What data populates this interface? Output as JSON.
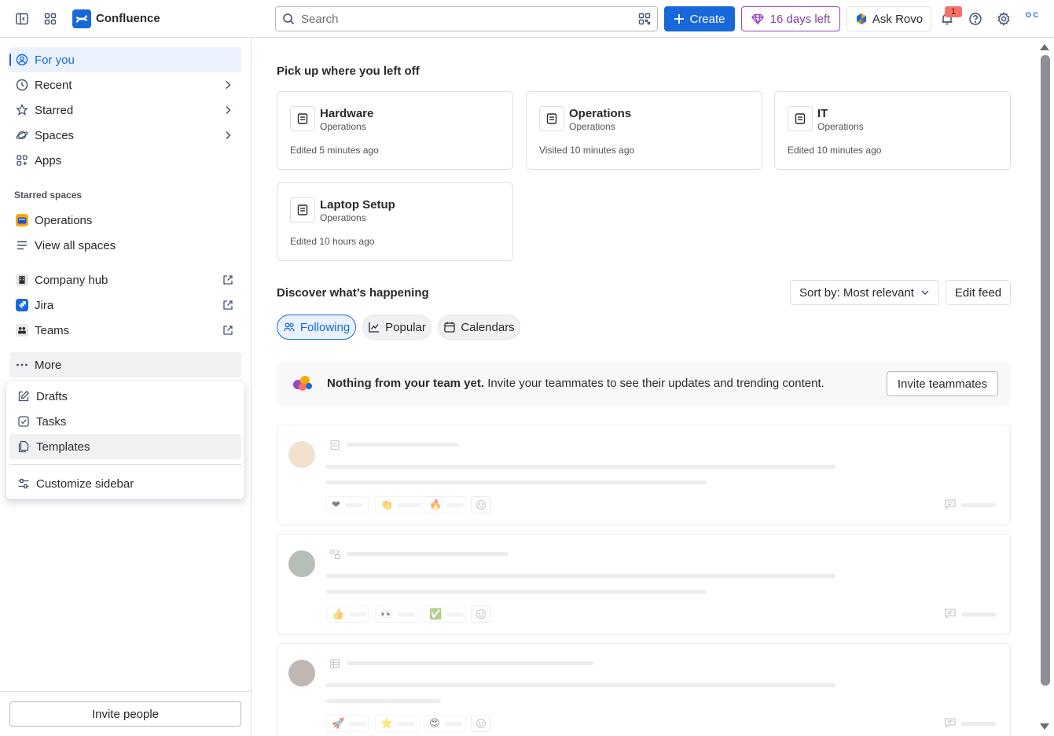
{
  "topbar": {
    "product_name": "Confluence",
    "search_placeholder": "Search",
    "create_label": "Create",
    "trial_label": "16 days left",
    "rovo_label": "Ask Rovo",
    "notification_count": "1",
    "avatar_initials": "O C"
  },
  "sidebar": {
    "items": [
      {
        "label": "For you"
      },
      {
        "label": "Recent"
      },
      {
        "label": "Starred"
      },
      {
        "label": "Spaces"
      },
      {
        "label": "Apps"
      }
    ],
    "starred_title": "Starred spaces",
    "starred": [
      {
        "label": "Operations"
      },
      {
        "label": "View all spaces"
      }
    ],
    "external": [
      {
        "label": "Company hub"
      },
      {
        "label": "Jira"
      },
      {
        "label": "Teams"
      }
    ],
    "more_label": "More",
    "more_menu": [
      {
        "label": "Drafts"
      },
      {
        "label": "Tasks"
      },
      {
        "label": "Templates"
      },
      {
        "label": "Customize sidebar"
      }
    ],
    "invite_label": "Invite people"
  },
  "main": {
    "recent_title": "Pick up where you left off",
    "cards": [
      {
        "title": "Hardware",
        "space": "Operations",
        "meta": "Edited 5 minutes ago"
      },
      {
        "title": "Operations",
        "space": "Operations",
        "meta": "Visited 10 minutes ago"
      },
      {
        "title": "IT",
        "space": "Operations",
        "meta": "Edited 10 minutes ago"
      },
      {
        "title": "Laptop Setup",
        "space": "Operations",
        "meta": "Edited 10 hours ago"
      }
    ],
    "discover_title": "Discover what’s happening",
    "sort_label": "Sort by: Most relevant",
    "edit_feed_label": "Edit feed",
    "tabs": [
      {
        "label": "Following"
      },
      {
        "label": "Popular"
      },
      {
        "label": "Calendars"
      }
    ],
    "empty_bold": "Nothing from your team yet.",
    "empty_text": " Invite your teammates to see their updates and trending content.",
    "invite_teammates_label": "Invite teammates"
  },
  "colors": {
    "brand": "#1868db",
    "trial": "#964ac0",
    "active_bg": "#e9f2fe"
  }
}
